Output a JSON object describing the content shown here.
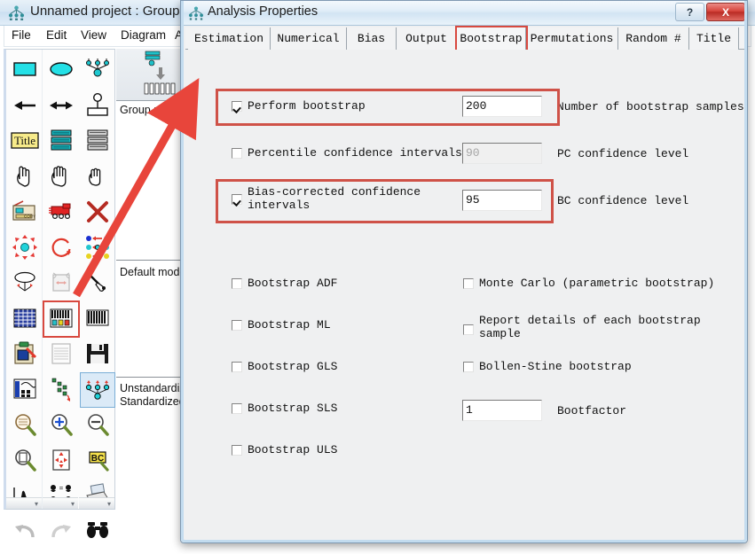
{
  "app": {
    "title": "Unnamed project : Group nu",
    "icon": "amos-path-diagram-icon",
    "menu": [
      "File",
      "Edit",
      "View",
      "Diagram",
      "A"
    ]
  },
  "panes": {
    "group_label": "Group numbe",
    "model_label": "Default mode",
    "unstandardized_label": "Unstandardiz",
    "standardized_label": "Standardized"
  },
  "palette": {
    "scroll_glyph": "▾",
    "icons": [
      "rectangle-observed-variable-icon",
      "ellipse-unobserved-variable-icon",
      "latent-variable-indicators-icon",
      "single-headed-arrow-icon",
      "double-headed-arrow-icon",
      "unique-variable-icon",
      "figure-caption-title-icon",
      "list-variables-in-dataset-icon",
      "list-variables-in-model-icon",
      "select-one-object-icon",
      "select-all-objects-icon",
      "deselect-all-objects-icon",
      "duplicate-objects-icon",
      "move-objects-icon",
      "erase-objects-icon",
      "change-shape-of-objects-icon",
      "rotate-indicators-icon",
      "reflect-indicators-icon",
      "move-parameter-values-icon",
      "scroll-the-path-diagram-icon",
      "touch-up-a-variable-icon",
      "select-data-file-icon",
      "analysis-properties-icon",
      "object-properties-icon",
      "drag-properties-icon",
      "preserve-symmetries-icon",
      "calculate-estimates-icon",
      "clipboard-copy-icon",
      "view-text-output-icon",
      "save-current-diagram-icon",
      "object-properties-panel-icon",
      "drag-properties-panel-icon",
      "preserve-symmetries-panel-icon",
      "zoom-in-on-area-icon",
      "zoom-in-icon",
      "zoom-out-icon",
      "show-whole-page-icon",
      "resize-to-fit-page-icon",
      "bayesian-estimation-icon",
      "multiple-group-analysis-icon",
      "print-icon",
      "undo-icon",
      "redo-icon",
      "search-icon"
    ]
  },
  "dialog": {
    "title": "Analysis Properties",
    "icon": "amos-path-diagram-icon",
    "buttons": {
      "help": "?",
      "close": "X"
    },
    "tabs": [
      {
        "label": "Estimation",
        "active": false
      },
      {
        "label": "Numerical",
        "active": false
      },
      {
        "label": "Bias",
        "active": false
      },
      {
        "label": "Output",
        "active": false
      },
      {
        "label": "Bootstrap",
        "active": true
      },
      {
        "label": "Permutations",
        "active": false
      },
      {
        "label": "Random #",
        "active": false
      },
      {
        "label": "Title",
        "active": false
      }
    ],
    "left_column": [
      {
        "label": "Perform bootstrap",
        "checked": true
      },
      {
        "label": "Percentile confidence intervals",
        "checked": false
      },
      {
        "label": "Bias-corrected confidence\nintervals",
        "checked": true
      },
      {
        "label": "Bootstrap ADF",
        "checked": false
      },
      {
        "label": "Bootstrap ML",
        "checked": false
      },
      {
        "label": "Bootstrap GLS",
        "checked": false
      },
      {
        "label": "Bootstrap SLS",
        "checked": false
      },
      {
        "label": "Bootstrap ULS",
        "checked": false
      }
    ],
    "right_column": [
      {
        "label": "Monte Carlo (parametric bootstrap)",
        "checked": false
      },
      {
        "label": "Report details of each bootstrap\nsample",
        "checked": false
      },
      {
        "label": "Bollen-Stine bootstrap",
        "checked": false
      }
    ],
    "fields": [
      {
        "value": "200",
        "caption": "Number of bootstrap samples",
        "disabled": false
      },
      {
        "value": "90",
        "caption": "PC confidence level",
        "disabled": true
      },
      {
        "value": "95",
        "caption": "BC confidence level",
        "disabled": false
      },
      {
        "value": "1",
        "caption": "Bootfactor",
        "disabled": false
      }
    ]
  },
  "annotations": {
    "color": "#cf5248",
    "boxes": [
      "bootstrap-tab",
      "perform-bootstrap-row",
      "bias-corrected-row",
      "analysis-properties-tool"
    ],
    "arrow": "analysis-properties-tool-to-dialog"
  }
}
